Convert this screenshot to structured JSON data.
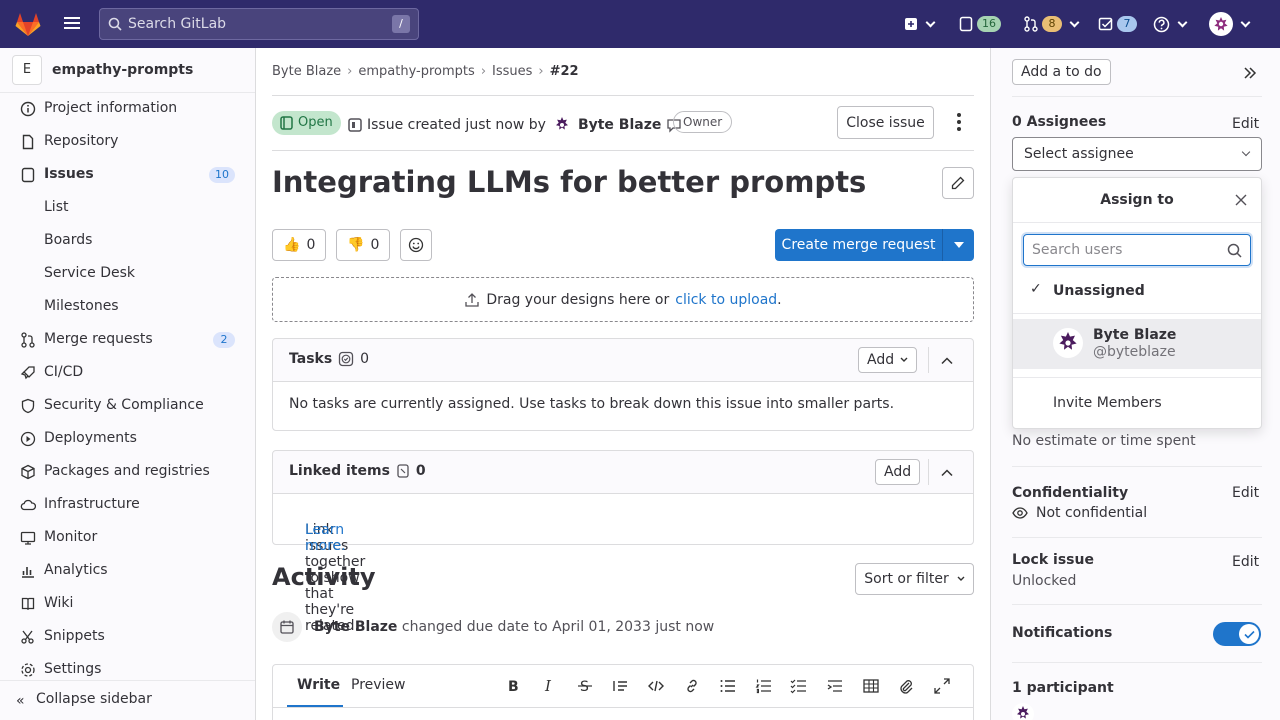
{
  "topbar": {
    "search_placeholder": "Search GitLab",
    "search_shortcut": "/",
    "issues_count": "16",
    "merge_requests_count": "8",
    "todos_count": "7"
  },
  "sidebar": {
    "project_initial": "E",
    "project_name": "empathy-prompts",
    "items": [
      {
        "label": "Project information",
        "icon": "info-icon"
      },
      {
        "label": "Repository",
        "icon": "doc-icon"
      },
      {
        "label": "Issues",
        "icon": "issues-icon",
        "count": "10"
      },
      {
        "label": "List"
      },
      {
        "label": "Boards"
      },
      {
        "label": "Service Desk"
      },
      {
        "label": "Milestones"
      },
      {
        "label": "Merge requests",
        "icon": "merge-request-icon",
        "count": "2"
      },
      {
        "label": "CI/CD",
        "icon": "rocket-icon"
      },
      {
        "label": "Security & Compliance",
        "icon": "shield-icon"
      },
      {
        "label": "Deployments",
        "icon": "deployments-icon"
      },
      {
        "label": "Packages and registries",
        "icon": "package-icon"
      },
      {
        "label": "Infrastructure",
        "icon": "cloud-icon"
      },
      {
        "label": "Monitor",
        "icon": "monitor-icon"
      },
      {
        "label": "Analytics",
        "icon": "chart-icon"
      },
      {
        "label": "Wiki",
        "icon": "book-icon"
      },
      {
        "label": "Snippets",
        "icon": "snippet-icon"
      },
      {
        "label": "Settings",
        "icon": "settings-icon"
      }
    ],
    "collapse_label": "Collapse sidebar"
  },
  "breadcrumb": {
    "items": [
      "Byte Blaze",
      "empathy-prompts",
      "Issues",
      "#22"
    ]
  },
  "issue": {
    "status": "Open",
    "created_prefix": "Issue created just now by",
    "author": "Byte Blaze",
    "role": "Owner",
    "close_label": "Close issue",
    "title": "Integrating LLMs for better prompts",
    "thumbs_up_count": "0",
    "thumbs_down_count": "0",
    "create_mr_label": "Create merge request",
    "drop_text": "Drag your designs here or",
    "drop_link": "click to upload",
    "drop_suffix": "."
  },
  "tasks": {
    "title": "Tasks",
    "count": "0",
    "add_label": "Add",
    "empty_text": "No tasks are currently assigned. Use tasks to break down this issue into smaller parts."
  },
  "linked": {
    "title": "Linked items",
    "count": "0",
    "add_label": "Add",
    "text": "Link issues together to show that they're related.",
    "learn_more": "Learn more."
  },
  "activity": {
    "title": "Activity",
    "sort_label": "Sort or filter",
    "event_user": "Byte Blaze",
    "event_text": "changed due date to April 01, 2033 just now"
  },
  "editor": {
    "write_tab": "Write",
    "preview_tab": "Preview"
  },
  "right": {
    "todo_label": "Add a to do",
    "assignees_label": "0 Assignees",
    "edit_label": "Edit",
    "select_assignee": "Select assignee",
    "dropdown_title": "Assign to",
    "search_placeholder": "Search users",
    "unassigned": "Unassigned",
    "user_name": "Byte Blaze",
    "user_handle": "@byteblaze",
    "invite": "Invite Members",
    "time_tracking": "No estimate or time spent",
    "confidentiality_label": "Confidentiality",
    "confidentiality_value": "Not confidential",
    "lock_label": "Lock issue",
    "lock_value": "Unlocked",
    "notifications_label": "Notifications",
    "participants_label": "1 participant"
  },
  "colors": {
    "topbar": "#2f2a6b",
    "primary": "#1f75cb",
    "status_bg": "#c3e6cd",
    "status_text": "#217645"
  }
}
